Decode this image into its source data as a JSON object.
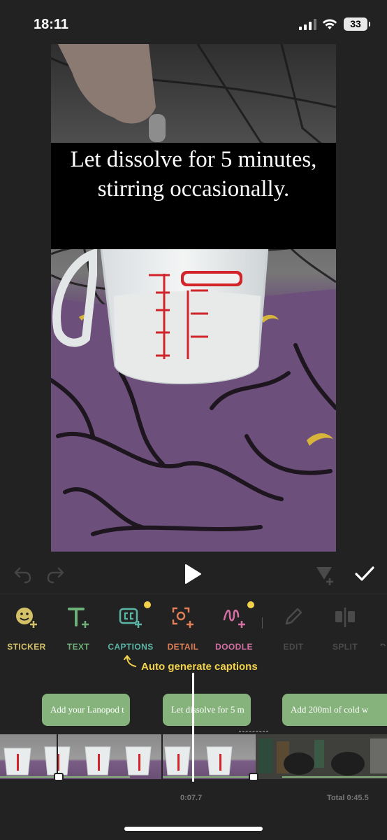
{
  "status_bar": {
    "time": "18:11",
    "battery": "33"
  },
  "preview": {
    "caption": "Let dissolve for 5 minutes,\nstirring occasionally."
  },
  "playback": {
    "undo": "undo-icon",
    "redo": "redo-icon",
    "play": "play-icon",
    "keyframe": "keyframe-icon",
    "done": "checkmark-icon"
  },
  "toolbar": {
    "tools": [
      {
        "label": "STICKER",
        "color": "#d4c067",
        "icon": "smiley-plus-icon"
      },
      {
        "label": "TEXT",
        "color": "#6fb07a",
        "icon": "text-plus-icon"
      },
      {
        "label": "CAPTIONS",
        "color": "#5bb5a6",
        "icon": "cc-plus-icon",
        "badge": true
      },
      {
        "label": "DETAIL",
        "color": "#e07f56",
        "icon": "focus-plus-icon"
      },
      {
        "label": "DOODLE",
        "color": "#d46ea3",
        "icon": "squiggle-plus-icon",
        "badge": true
      },
      {
        "label": "EDIT",
        "color": "#4a4a4a",
        "icon": "pencil-icon"
      },
      {
        "label": "SPLIT",
        "color": "#4a4a4a",
        "icon": "split-icon"
      },
      {
        "label": "D",
        "color": "#4a4a4a",
        "icon": ""
      }
    ]
  },
  "hint": {
    "text": "Auto generate captions",
    "color": "#f2d24b"
  },
  "timeline": {
    "clips": [
      "Add your Lanopod t",
      "Let dissolve for 5 m",
      "Add 200ml of cold w"
    ],
    "current_time": "0:07.7",
    "total": "Total 0:45.5",
    "accent": "#86b37b"
  }
}
